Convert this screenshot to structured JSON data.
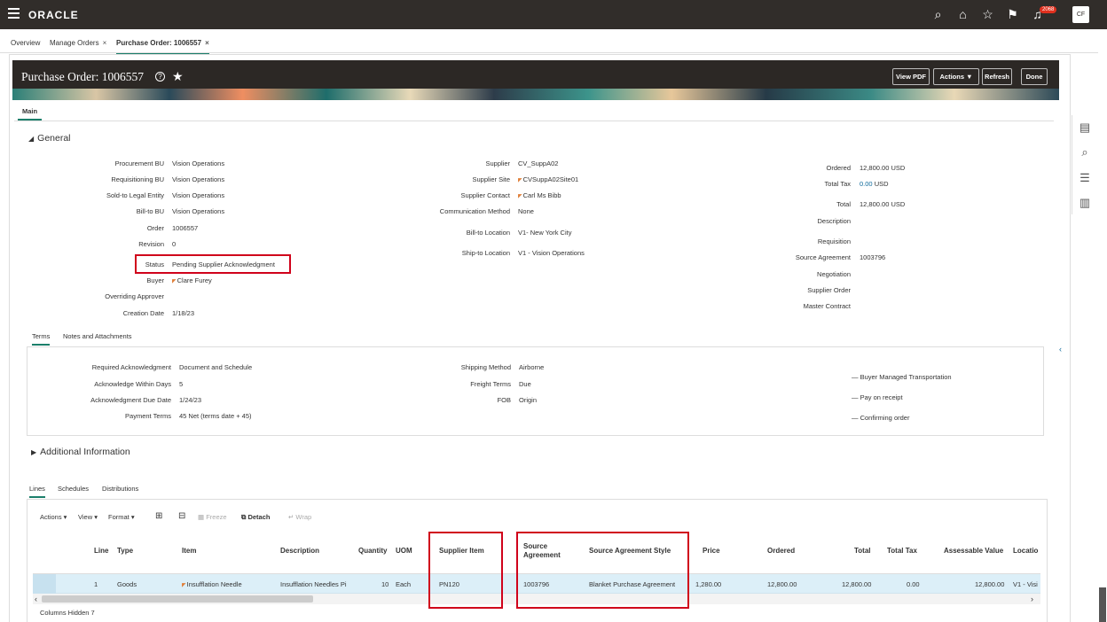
{
  "topbar": {
    "logo": "ORACLE",
    "notif_count": "2068",
    "avatar": "CF"
  },
  "tabs": {
    "overview": "Overview",
    "manage": "Manage Orders",
    "po": "Purchase Order: 1006557",
    "close": "×"
  },
  "header": {
    "title": "Purchase Order: 1006557",
    "help": "?",
    "view_pdf": "View PDF",
    "actions": "Actions ▼",
    "refresh": "Refresh",
    "done": "Done"
  },
  "main_tab": "Main",
  "general": {
    "title": "General",
    "col1": [
      [
        "Procurement BU",
        "Vision Operations"
      ],
      [
        "Requisitioning BU",
        "Vision Operations"
      ],
      [
        "Sold-to Legal Entity",
        "Vision Operations"
      ],
      [
        "Bill-to BU",
        "Vision Operations"
      ],
      [
        "Order",
        "1006557"
      ],
      [
        "Revision",
        "0"
      ]
    ],
    "status_label": "Status",
    "status_value": "Pending Supplier Acknowledgment",
    "buyer_label": "Buyer",
    "buyer_value": "Clare Furey",
    "overriding_label": "Overriding Approver",
    "creation_label": "Creation Date",
    "creation_value": "1/18/23",
    "supplier_label": "Supplier",
    "supplier_value": "CV_SuppA02",
    "site_label": "Supplier Site",
    "site_value": "CVSuppA02Site01",
    "contact_label": "Supplier Contact",
    "contact_value": "Carl Ms Bibb",
    "comm_label": "Communication Method",
    "comm_value": "None",
    "billto_label": "Bill-to Location",
    "billto_value": "V1- New York City",
    "shipto_label": "Ship-to Location",
    "shipto_value": "V1 - Vision Operations",
    "ordered_label": "Ordered",
    "ordered_value": "12,800.00",
    "usd": "USD",
    "tax_label": "Total Tax",
    "tax_value": "0.00",
    "total_label": "Total",
    "total_value": "12,800.00",
    "desc_label": "Description",
    "req_label": "Requisition",
    "sa_label": "Source Agreement",
    "sa_value": "1003796",
    "neg_label": "Negotiation",
    "so_label": "Supplier Order",
    "mc_label": "Master Contract"
  },
  "terms_tabs": {
    "terms": "Terms",
    "notes": "Notes and Attachments"
  },
  "terms": {
    "req_ack_label": "Required Acknowledgment",
    "req_ack_value": "Document and Schedule",
    "ack_days_label": "Acknowledge Within Days",
    "ack_days_value": "5",
    "ack_due_label": "Acknowledgment Due Date",
    "ack_due_value": "1/24/23",
    "pay_label": "Payment Terms",
    "pay_value": "45 Net (terms date + 45)",
    "ship_label": "Shipping Method",
    "ship_value": "Airborne",
    "freight_label": "Freight Terms",
    "freight_value": "Due",
    "fob_label": "FOB",
    "fob_value": "Origin",
    "chk1": "Buyer Managed Transportation",
    "chk2": "Pay on receipt",
    "chk3": "Confirming order"
  },
  "additional": "Additional Information",
  "line_tabs": {
    "lines": "Lines",
    "schedules": "Schedules",
    "distributions": "Distributions"
  },
  "toolbar": {
    "actions": "Actions ▾",
    "view": "View ▾",
    "format": "Format ▾",
    "freeze": "Freeze",
    "detach": "Detach",
    "wrap": "Wrap"
  },
  "columns": {
    "line": "Line",
    "type": "Type",
    "item": "Item",
    "desc": "Description",
    "qty": "Quantity",
    "uom": "UOM",
    "supplier_item": "Supplier Item",
    "source_agreement": "Source Agreement",
    "sa_style": "Source Agreement Style",
    "price": "Price",
    "ordered": "Ordered",
    "total": "Total",
    "total_tax": "Total Tax",
    "assessable": "Assessable Value",
    "location": "Locatio"
  },
  "row": {
    "line": "1",
    "type": "Goods",
    "item": "Insufflation Needle",
    "desc": "Insufflation Needles Pi",
    "qty": "10",
    "uom": "Each",
    "supplier_item": "PN120",
    "source_agreement": "1003796",
    "sa_style": "Blanket Purchase Agreement",
    "price": "1,280.00",
    "ordered": "12,800.00",
    "total": "12,800.00",
    "total_tax": "0.00",
    "assessable": "12,800.00",
    "location": "V1 - Visi"
  },
  "columns_hidden": "Columns Hidden  7"
}
